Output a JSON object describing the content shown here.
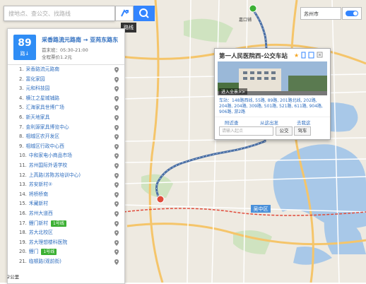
{
  "search": {
    "placeholder": "搜地点、查公交、找路线"
  },
  "route_tooltip": "路线",
  "city": {
    "label": "苏州市"
  },
  "line": {
    "number": "89",
    "badge_sub": "路↓",
    "title": "采香路流元路南 → 亚苑东路东",
    "time": "首末班：05:30-21:00",
    "fare": "全程票价1.2元"
  },
  "stops": [
    {
      "num": "1.",
      "name": "采香路流元路南"
    },
    {
      "num": "2.",
      "name": "富化家园"
    },
    {
      "num": "3.",
      "name": "元和科技园"
    },
    {
      "num": "4.",
      "name": "横江之星城铺路"
    },
    {
      "num": "5.",
      "name": "汇海家具世博广场"
    },
    {
      "num": "6.",
      "name": "新天地家具"
    },
    {
      "num": "7.",
      "name": "金利源家具博览中心"
    },
    {
      "num": "8.",
      "name": "相城区农开发区"
    },
    {
      "num": "9.",
      "name": "相城区行政中心西"
    },
    {
      "num": "10.",
      "name": "中和家电小商品市场"
    },
    {
      "num": "11.",
      "name": "苏州国际外语学校"
    },
    {
      "num": "12.",
      "name": "上高路(苏陈苏培训中心)"
    },
    {
      "num": "13.",
      "name": "苏安新村②"
    },
    {
      "num": "14.",
      "name": "将桥桥南"
    },
    {
      "num": "15.",
      "name": "禾藏新村"
    },
    {
      "num": "16.",
      "name": "苏州大道西"
    },
    {
      "num": "17.",
      "name": "鲤门新村",
      "metro": "1号线"
    },
    {
      "num": "18.",
      "name": "苏大北校区"
    },
    {
      "num": "19.",
      "name": "苏大理想楼科医院"
    },
    {
      "num": "20.",
      "name": "鲤门",
      "metro": "1号线"
    },
    {
      "num": "21.",
      "name": "临顿路(观前街)"
    }
  ],
  "popup": {
    "title": "第一人民医院西-公交车站",
    "photo_caption": "进入全景>>",
    "lines_text": "车站：148路西线, 55路, 89路, 201路北线, 202路, 204路, 204路, 309路, 501路, 521路, 611路, 904路, 906路, 游2路",
    "action_nearby": "附近查",
    "action_from": "从这出发",
    "action_to": "去我这",
    "input_placeholder": "请输入起点",
    "btn_bus": "公交",
    "btn_drive": "驾车"
  },
  "map_labels": {
    "district_center": "吴中区",
    "station_label": "嘉口铺",
    "scale": "2公里"
  },
  "colors": {
    "route": "#4a6fa5",
    "accent": "#3385ff",
    "badge": "#2f8df5",
    "metro": "#3cb034",
    "water": "#a8c8e8",
    "land": "#eeeae1"
  }
}
